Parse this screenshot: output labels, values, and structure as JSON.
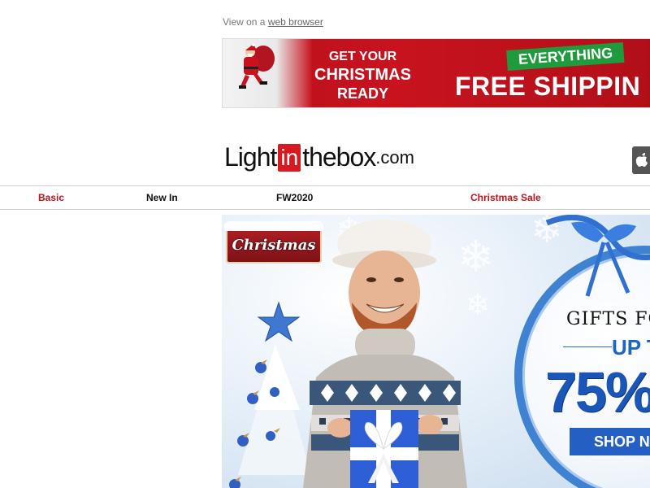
{
  "header": {
    "view_prefix": "View on a ",
    "view_link": "web browser"
  },
  "promo": {
    "line1": "GET YOUR",
    "line2": "CHRISTMAS",
    "line3": "READY",
    "badge": "EVERYTHING",
    "headline": "FREE SHIPPIN",
    "colors": {
      "red": "#c8131f",
      "green": "#1f9a3c"
    }
  },
  "logo": {
    "part1": "Light",
    "part2": "in",
    "part3": "thebox",
    "part4": ".com",
    "accent": "#d71920"
  },
  "nav": {
    "items": [
      {
        "label": "Basic",
        "color": "red"
      },
      {
        "label": "New In",
        "color": "black"
      },
      {
        "label": "FW2020",
        "color": "black"
      },
      {
        "label": "Christmas Sale",
        "color": "red"
      }
    ]
  },
  "hero": {
    "sign": "Christmas",
    "gifts_for": "GIFTS FO",
    "up_to": "UP T",
    "percent": "75%",
    "shop_now": "SHOP N",
    "icons": [
      "star-icon",
      "snowflake-icon",
      "gift-box-icon",
      "ribbon-icon",
      "apple-icon",
      "santa-icon"
    ]
  }
}
